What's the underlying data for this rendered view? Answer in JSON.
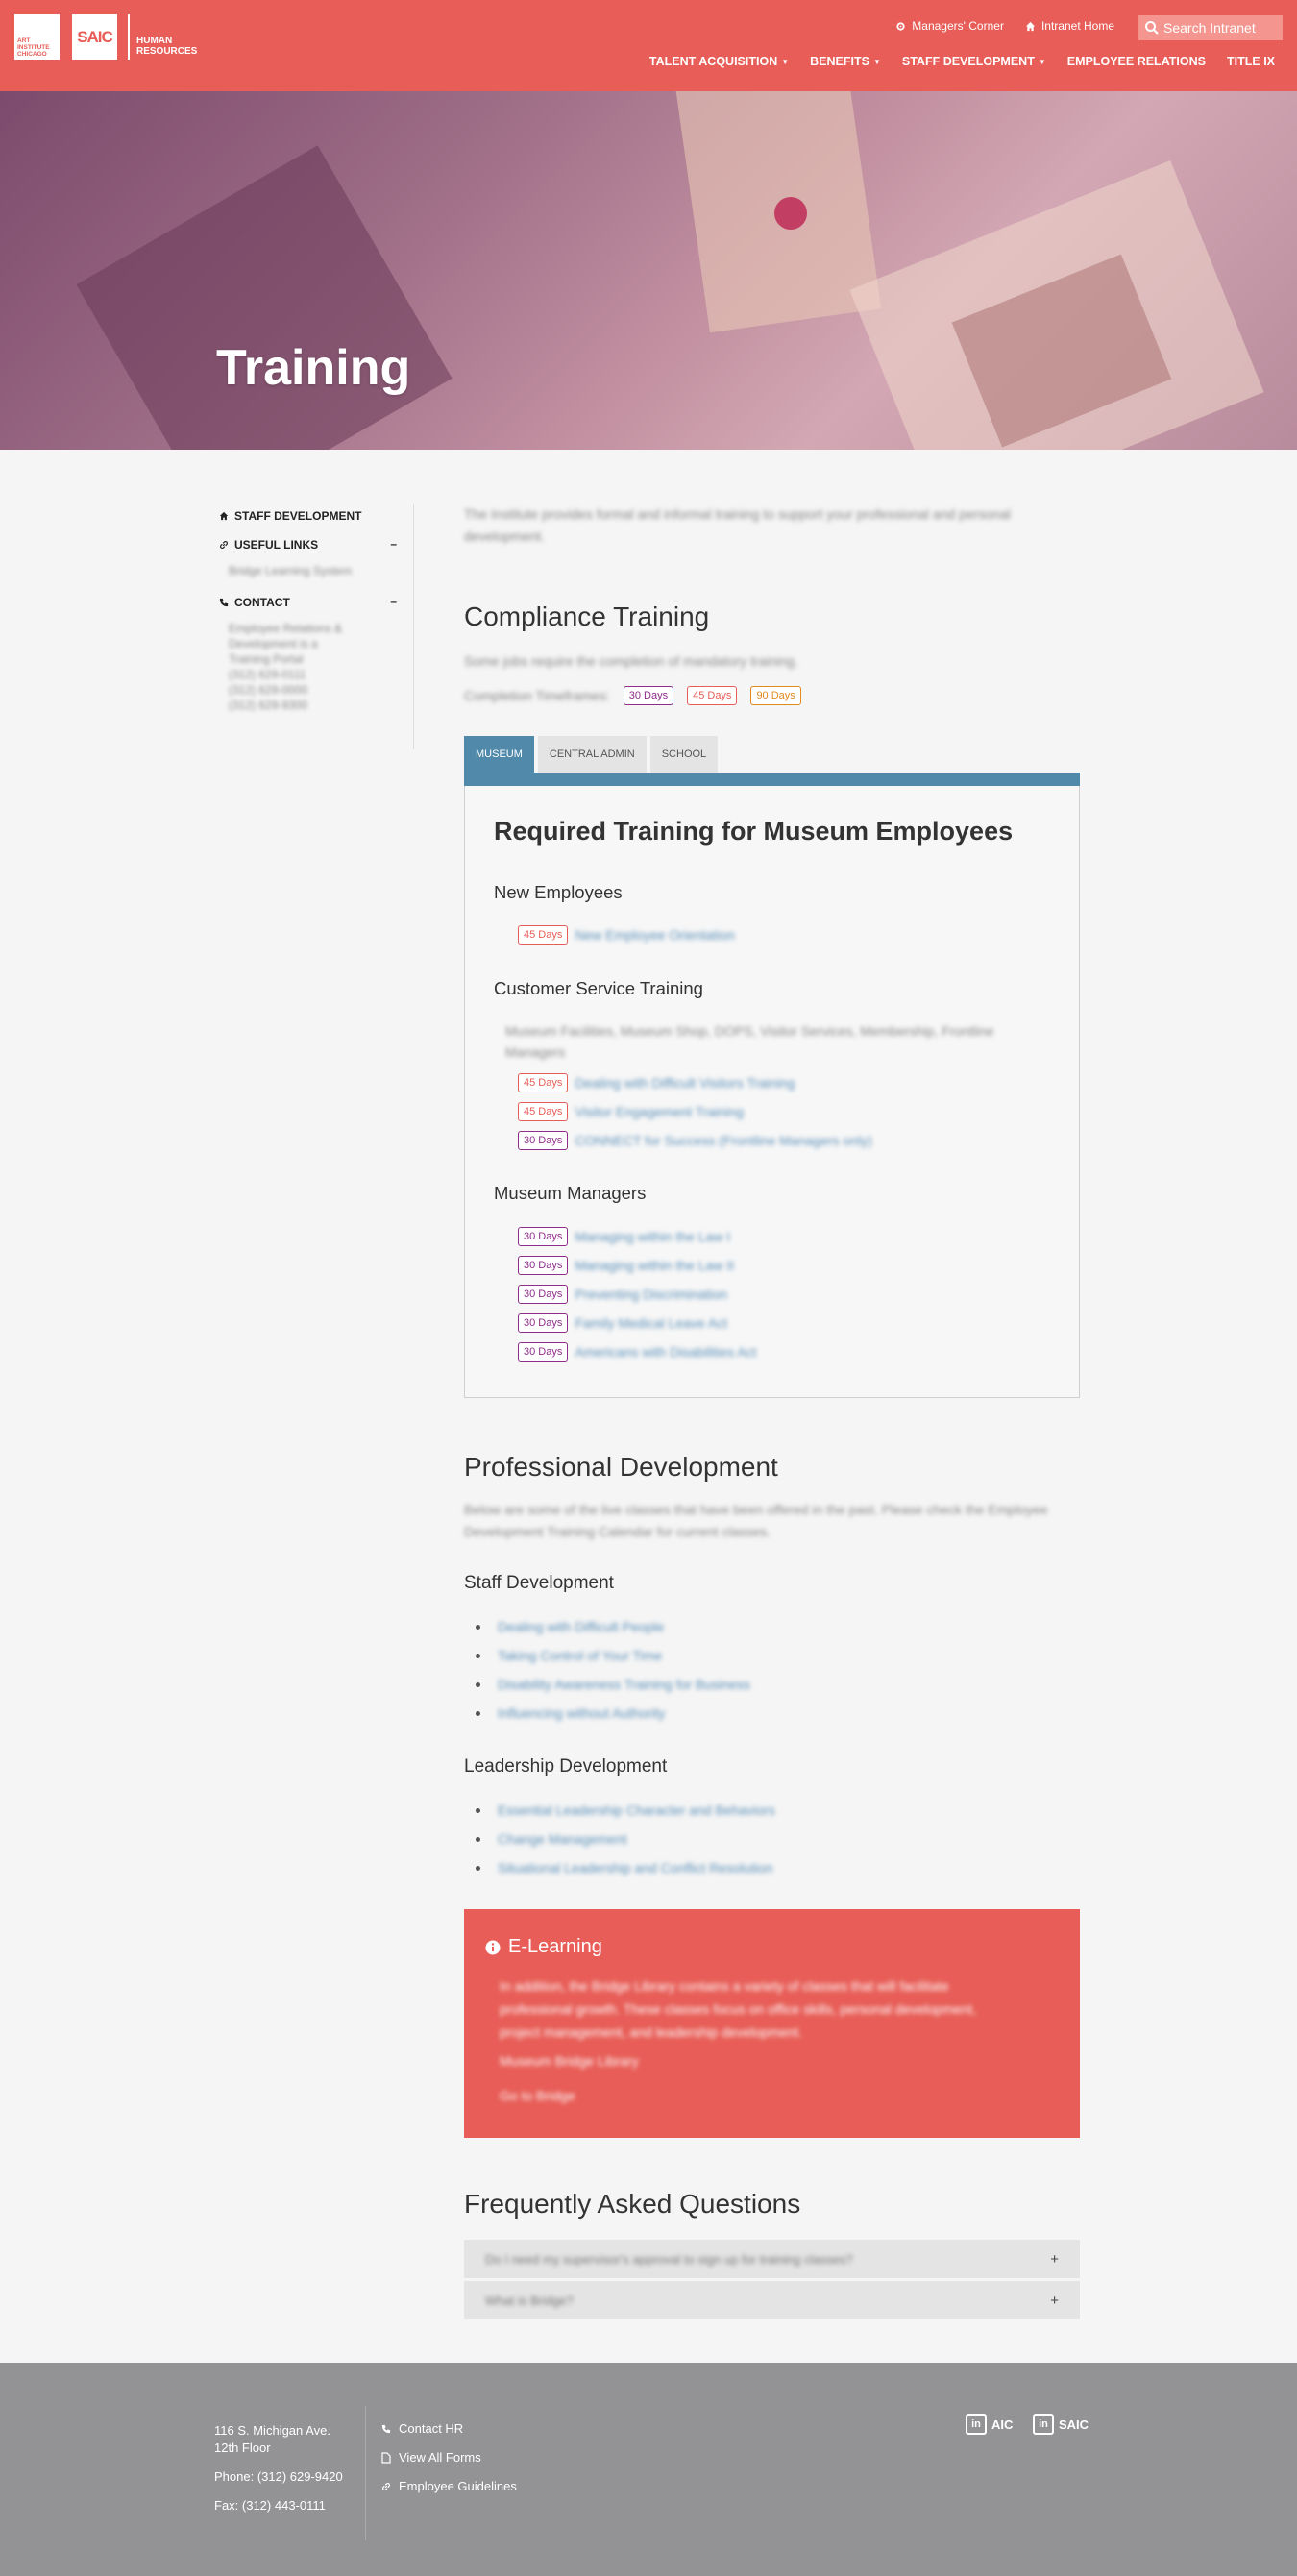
{
  "header": {
    "logo_aic": "Art Institute Chicago",
    "logo_saic": "SAIC",
    "logo_hr": "Human Resources",
    "util_links": [
      "Managers' Corner",
      "Intranet Home"
    ],
    "search_placeholder": "Search Intranet",
    "nav": [
      "Talent Acquisition",
      "Benefits",
      "Staff Development",
      "Employee Relations",
      "Title IX"
    ]
  },
  "hero": {
    "title": "Training",
    "slide_count": 3,
    "active_slide": 1
  },
  "sidebar": {
    "staff_development": "Staff Development",
    "useful_links": "Useful Links",
    "useful_links_items": [
      "Bridge Learning System"
    ],
    "contact": "Contact",
    "contact_lines": [
      "Employee Relations &",
      "Development is a",
      "Training Portal",
      "(312) 629-0111",
      "(312) 629-0000",
      "(312) 629-9300"
    ],
    "collapse_symbol": "–"
  },
  "intro": {
    "text": "The Institute provides formal and informal training to support your professional and personal development."
  },
  "compliance": {
    "title": "Compliance Training",
    "subtitle": "Some jobs require the completion of mandatory training.",
    "timeframes_label": "Completion Timeframes:",
    "badges": [
      "30 Days",
      "45 Days",
      "90 Days"
    ]
  },
  "tabs": [
    "Museum",
    "Central Admin",
    "School"
  ],
  "panel": {
    "title": "Required Training for Museum Employees",
    "new_employees": {
      "heading": "New Employees",
      "items": [
        {
          "badge": "45 Days",
          "text": "New Employee Orientation"
        }
      ]
    },
    "customer_service": {
      "heading": "Customer Service Training",
      "note": "Museum Facilities, Museum Shop, DOPS, Visitor Services, Membership, Frontline Managers",
      "items": [
        {
          "badge": "45 Days",
          "text": "Dealing with Difficult Visitors Training"
        },
        {
          "badge": "45 Days",
          "text": "Visitor Engagement Training"
        },
        {
          "badge": "30 Days",
          "text": "CONNECT for Success (Frontline Managers only)"
        }
      ]
    },
    "museum_managers": {
      "heading": "Museum Managers",
      "items": [
        {
          "badge": "30 Days",
          "text": "Managing within the Law I"
        },
        {
          "badge": "30 Days",
          "text": "Managing within the Law II"
        },
        {
          "badge": "30 Days",
          "text": "Preventing Discrimination"
        },
        {
          "badge": "30 Days",
          "text": "Family Medical Leave Act"
        },
        {
          "badge": "30 Days",
          "text": "Americans with Disabilities Act"
        }
      ]
    }
  },
  "professional": {
    "title": "Professional Development",
    "intro": "Below are some of the live classes that have been offered in the past. Please check the Employee Development Training Calendar for current classes.",
    "staff_heading": "Staff Development",
    "staff_items": [
      "Dealing with Difficult People",
      "Taking Control of Your Time",
      "Disability Awareness Training for Business",
      "Influencing without Authority"
    ],
    "leadership_heading": "Leadership Development",
    "leadership_items": [
      "Essential Leadership Character and Behaviors",
      "Change Management",
      "Situational Leadership and Conflict Resolution"
    ]
  },
  "elearning": {
    "title": "E-Learning",
    "para1": "In addition, the Bridge Library contains a variety of classes that will facilitate professional growth. These classes focus on office skills, personal development, project management, and leadership development.",
    "para2": "Museum Bridge Library",
    "para3": "Go to Bridge"
  },
  "faq": {
    "title": "Frequently Asked Questions",
    "items": [
      "Do I need my supervisor's approval to sign up for training classes?",
      "What is Bridge?"
    ],
    "expand_symbol": "+"
  },
  "footer": {
    "address1": "116 S. Michigan Ave.",
    "address2": "12th Floor",
    "phone": "Phone: (312) 629-9420",
    "fax": "Fax: (312) 443-0111",
    "links": [
      "Contact HR",
      "View All Forms",
      "Employee Guidelines"
    ],
    "social": [
      "AIC",
      "SAIC"
    ],
    "linkedin_mark": "in"
  },
  "colors": {
    "brand": "#e85d57",
    "tab_active": "#5089aa",
    "badge_30": "#8e2d8a",
    "badge_45": "#e85d57",
    "badge_90": "#e08a1e",
    "footer": "#939396"
  },
  "icons": [
    "search-icon",
    "home-icon",
    "link-icon",
    "phone-icon",
    "info-icon",
    "file-icon",
    "linkedin-icon",
    "gear-icon"
  ]
}
